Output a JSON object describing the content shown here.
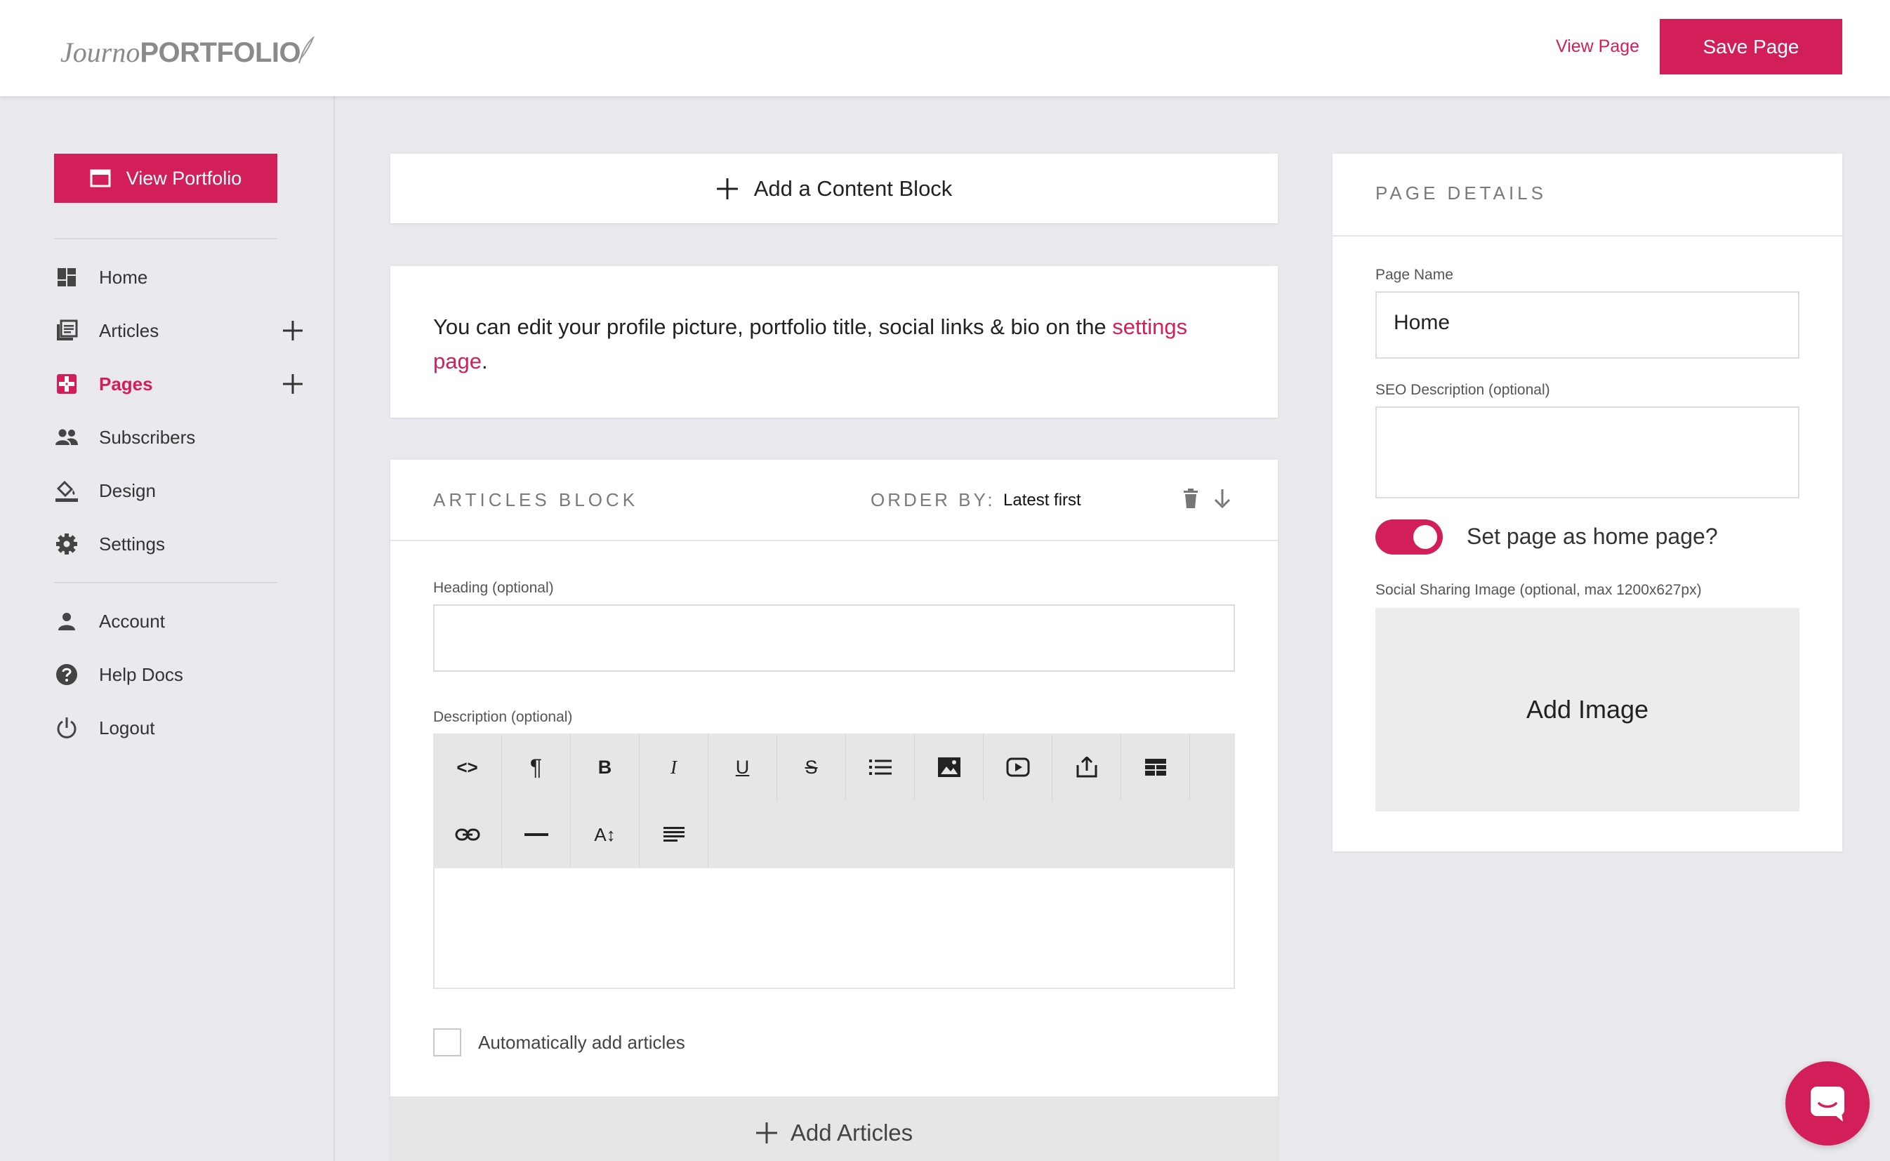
{
  "header": {
    "logo_part1": "Journo",
    "logo_part2": "PORTFOLIO",
    "view_page": "View Page",
    "save_page": "Save Page"
  },
  "sidebar": {
    "view_portfolio": "View Portfolio",
    "items": [
      {
        "label": "Home",
        "icon": "dashboard-icon"
      },
      {
        "label": "Articles",
        "icon": "articles-icon"
      },
      {
        "label": "Pages",
        "icon": "pages-icon",
        "active": true
      },
      {
        "label": "Subscribers",
        "icon": "people-icon"
      },
      {
        "label": "Design",
        "icon": "paint-bucket-icon"
      },
      {
        "label": "Settings",
        "icon": "gear-icon"
      }
    ],
    "bottom_items": [
      {
        "label": "Account",
        "icon": "person-icon"
      },
      {
        "label": "Help Docs",
        "icon": "help-icon"
      },
      {
        "label": "Logout",
        "icon": "power-icon"
      }
    ]
  },
  "main": {
    "add_block": "Add a Content Block",
    "info_text": "You can edit your profile picture, portfolio title, social links & bio on the ",
    "info_link": "settings page",
    "info_end": ".",
    "articles_block": {
      "title": "ARTICLES BLOCK",
      "order_by_label": "ORDER BY:",
      "order_by_value": "Latest first",
      "heading_label": "Heading (optional)",
      "heading_value": "",
      "description_label": "Description (optional)",
      "toolbar": [
        "code-view-icon",
        "paragraph-icon",
        "bold-icon",
        "italic-icon",
        "underline-icon",
        "strikethrough-icon",
        "list-icon",
        "image-icon",
        "video-icon",
        "embed-icon",
        "table-icon",
        "link-icon",
        "horizontal-rule-icon",
        "font-size-icon",
        "align-icon"
      ],
      "auto_add_label": "Automatically add articles",
      "auto_add_checked": false,
      "add_articles": "Add Articles"
    }
  },
  "page_details": {
    "title": "PAGE DETAILS",
    "page_name_label": "Page Name",
    "page_name_value": "Home",
    "seo_label": "SEO Description (optional)",
    "seo_value": "",
    "home_toggle_label": "Set page as home page?",
    "home_toggle_on": true,
    "social_image_label": "Social Sharing Image (optional, max 1200x627px)",
    "add_image": "Add Image"
  },
  "colors": {
    "accent": "#d21f5a",
    "background": "#e9e9ee"
  }
}
